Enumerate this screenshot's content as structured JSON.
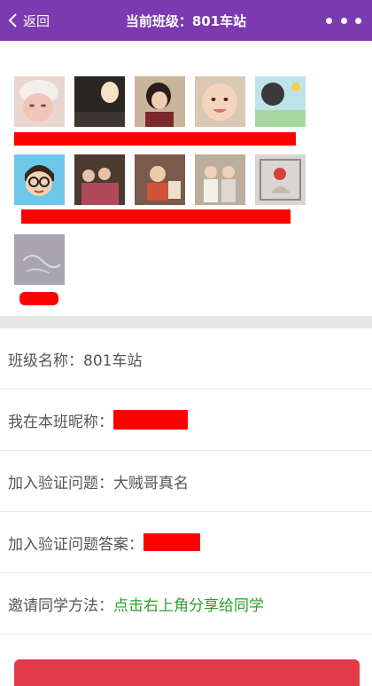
{
  "header": {
    "back_label": "返回",
    "title": "当前班级：801车站",
    "bg_color": "#7b3ab0"
  },
  "members": {
    "rows": [
      [
        "avatar-baby-hat",
        "avatar-dark-room",
        "avatar-woman",
        "avatar-baby-smile",
        "avatar-cartoon-tile"
      ],
      [
        "avatar-cartoon-glasses",
        "avatar-group-photo",
        "avatar-child-play",
        "avatar-two-kids",
        "avatar-toy"
      ],
      [
        "avatar-sketch"
      ]
    ]
  },
  "info": {
    "class_name_label": "班级名称：",
    "class_name_value": "801车站",
    "nickname_label": "我在本班昵称：",
    "question_label": "加入验证问题：",
    "question_value": "大贼哥真名",
    "answer_label": "加入验证问题答案：",
    "invite_label": "邀请同学方法：",
    "invite_value": "点击右上角分享给同学",
    "invite_color": "#2aa02a"
  },
  "bottom_button_color": "#e33b4a"
}
